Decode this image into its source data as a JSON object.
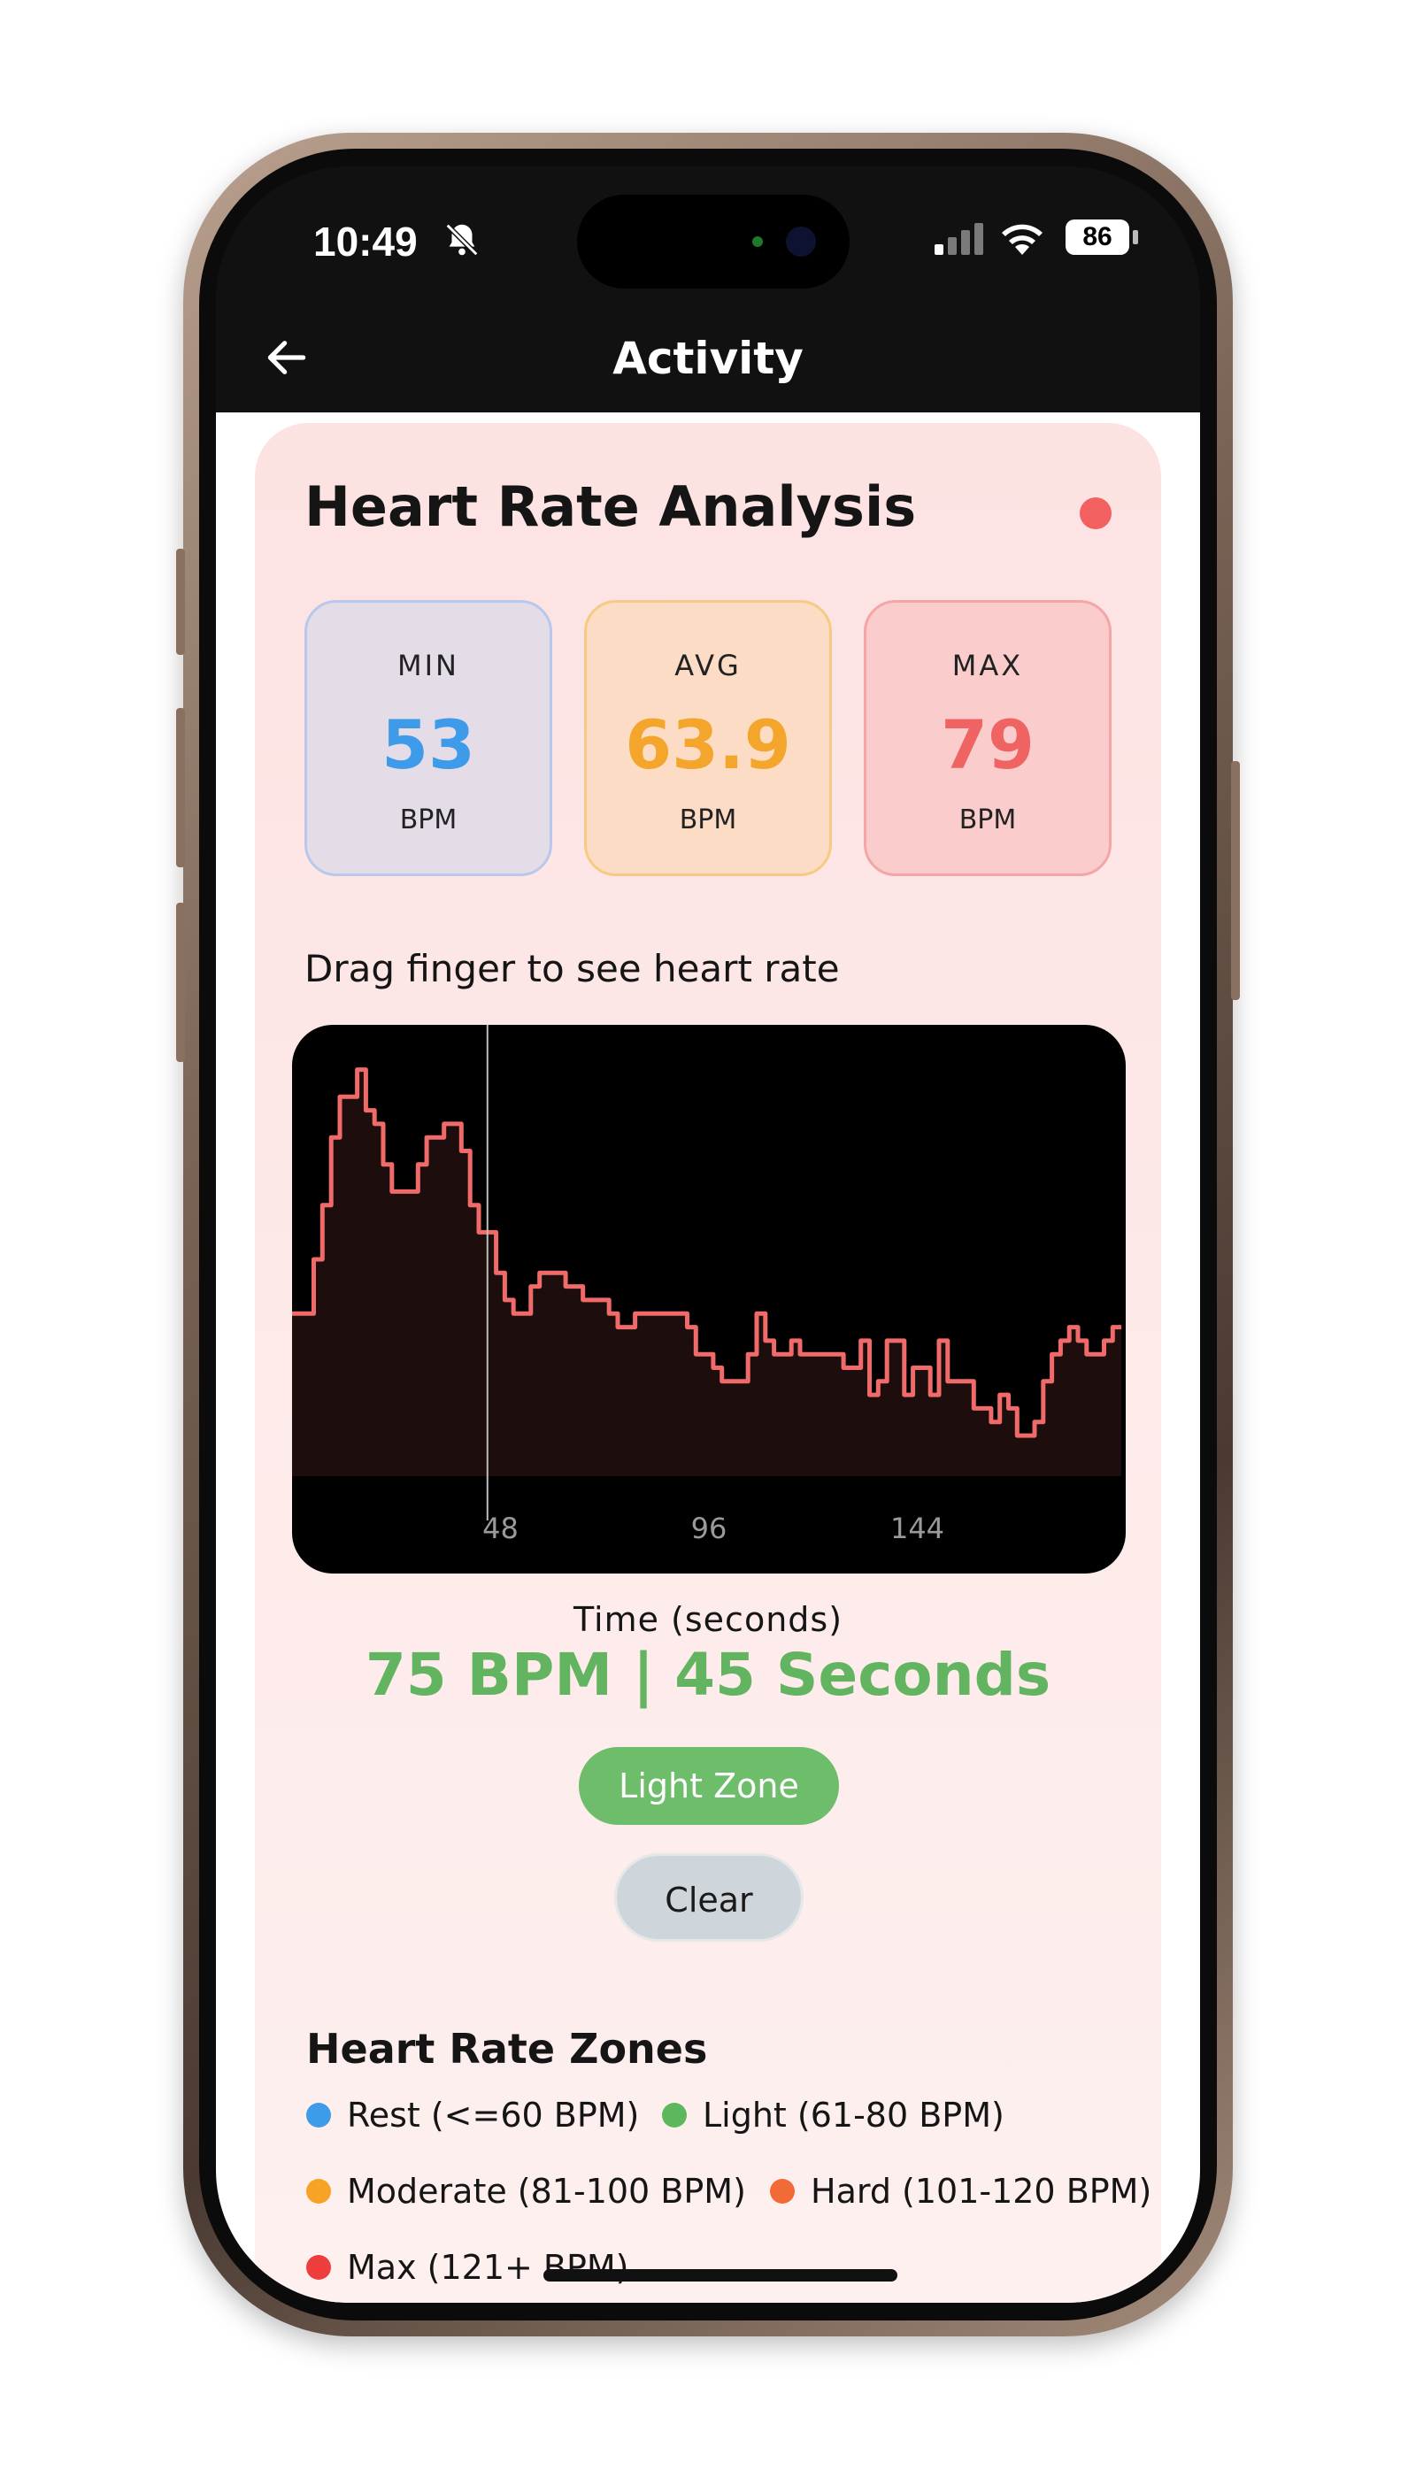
{
  "status_bar": {
    "time": "10:49",
    "battery": "86",
    "icons": [
      "bell-slash-icon",
      "signal-icon",
      "wifi-icon",
      "battery-icon"
    ]
  },
  "app_bar": {
    "title": "Activity",
    "back_icon": "arrow-left-icon"
  },
  "card": {
    "title": "Heart Rate Analysis",
    "status_color": "#f26060"
  },
  "stats": {
    "min": {
      "label": "MIN",
      "value": "53",
      "unit": "BPM",
      "color": "#3d9be9"
    },
    "avg": {
      "label": "AVG",
      "value": "63.9",
      "unit": "BPM",
      "color": "#f3a52c"
    },
    "max": {
      "label": "MAX",
      "value": "79",
      "unit": "BPM",
      "color": "#ef6363"
    }
  },
  "drag_hint": "Drag finger to see heart rate",
  "chart_data": {
    "type": "line",
    "xlabel": "Time (seconds)",
    "ylabel": "",
    "x_ticks": [
      "48",
      "96",
      "144"
    ],
    "xlim": [
      0,
      192
    ],
    "ylim": [
      50,
      82
    ],
    "cursor_x": 45,
    "line_color": "#f06a6a",
    "x": [
      0,
      3,
      5,
      7,
      9,
      11,
      13,
      15,
      17,
      19,
      21,
      23,
      25,
      27,
      29,
      31,
      33,
      35,
      37,
      39,
      41,
      43,
      45,
      47,
      49,
      51,
      53,
      55,
      57,
      59,
      61,
      63,
      65,
      67,
      69,
      71,
      73,
      75,
      77,
      79,
      81,
      83,
      85,
      87,
      89,
      91,
      93,
      95,
      97,
      99,
      101,
      103,
      105,
      107,
      109,
      111,
      113,
      115,
      117,
      119,
      121,
      123,
      125,
      127,
      129,
      131,
      133,
      135,
      137,
      139,
      141,
      143,
      145,
      147,
      149,
      151,
      153,
      155,
      157,
      159,
      161,
      163,
      165,
      167,
      169,
      171,
      173,
      175,
      177,
      179,
      181,
      183,
      185,
      187,
      189,
      191
    ],
    "y": [
      62,
      62,
      66,
      70,
      75,
      78,
      78,
      80,
      77,
      76,
      73,
      71,
      71,
      71,
      73,
      75,
      75,
      76,
      76,
      74,
      70,
      68,
      68,
      65,
      63,
      62,
      62,
      64,
      65,
      65,
      65,
      64,
      64,
      63,
      63,
      63,
      62,
      61,
      61,
      62,
      62,
      62,
      62,
      62,
      62,
      61,
      59,
      59,
      58,
      57,
      57,
      57,
      59,
      62,
      60,
      59,
      59,
      60,
      59,
      59,
      59,
      59,
      59,
      58,
      58,
      60,
      56,
      57,
      60,
      60,
      56,
      58,
      58,
      56,
      60,
      57,
      57,
      57,
      55,
      55,
      54,
      56,
      55,
      53,
      53,
      54,
      57,
      59,
      60,
      61,
      60,
      59,
      59,
      60,
      61,
      61
    ]
  },
  "readout": {
    "text": "75 BPM | 45 Seconds",
    "color": "#63b461"
  },
  "zone_pill": {
    "label": "Light Zone",
    "color": "#6dbd6b"
  },
  "clear_button": {
    "label": "Clear"
  },
  "zones": {
    "title": "Heart Rate Zones",
    "items": [
      {
        "label": "Rest (<=60 BPM)",
        "color": "#3d9be9"
      },
      {
        "label": "Light (61-80 BPM)",
        "color": "#5cb85c"
      },
      {
        "label": "Moderate (81-100 BPM)",
        "color": "#f7a325"
      },
      {
        "label": "Hard (101-120 BPM)",
        "color": "#f26a36"
      },
      {
        "label": "Max (121+ BPM)",
        "color": "#ee3d3d"
      }
    ]
  }
}
